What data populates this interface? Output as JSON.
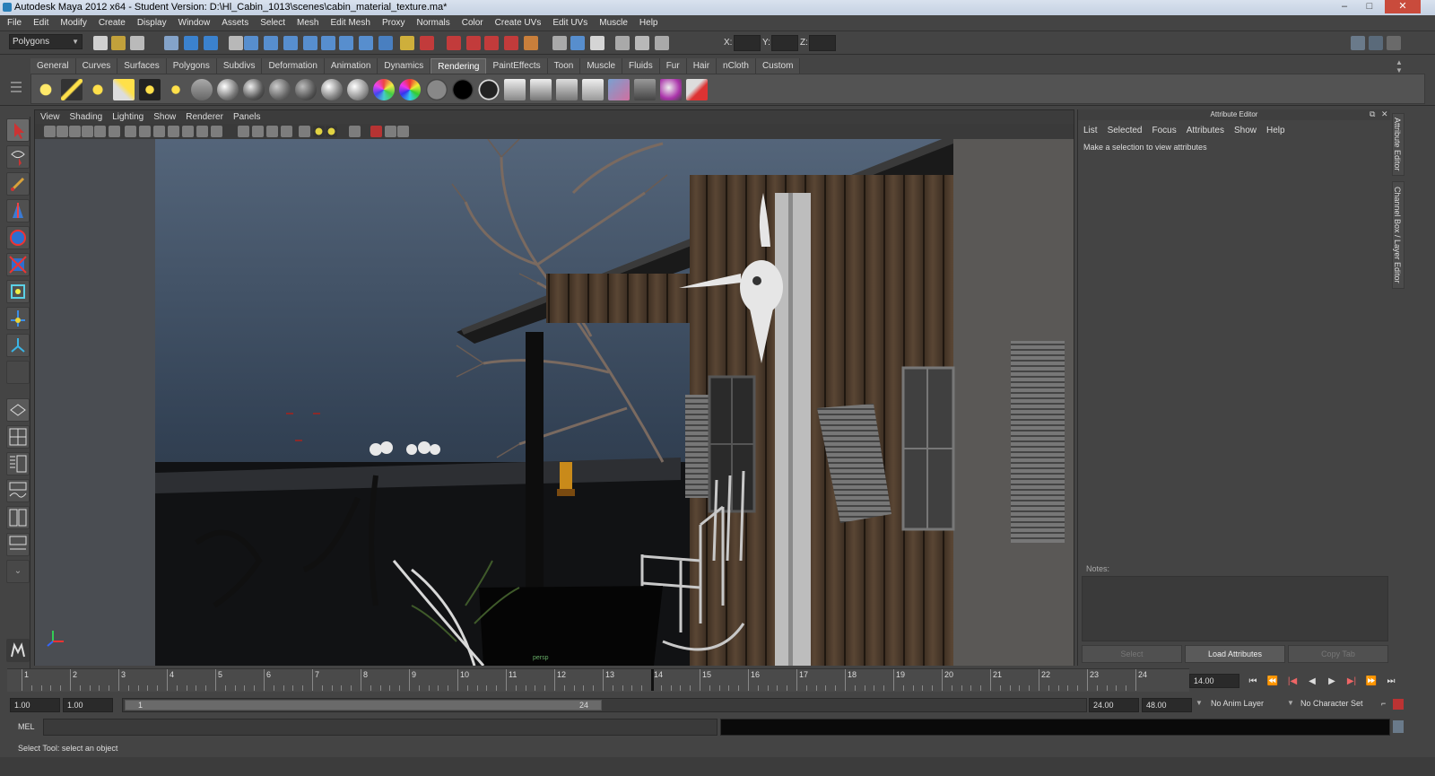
{
  "window": {
    "title": "Autodesk Maya 2012 x64 - Student Version: D:\\Hl_Cabin_1013\\scenes\\cabin_material_texture.ma*"
  },
  "menubar": [
    "File",
    "Edit",
    "Modify",
    "Create",
    "Display",
    "Window",
    "Assets",
    "Select",
    "Mesh",
    "Edit Mesh",
    "Proxy",
    "Normals",
    "Color",
    "Create UVs",
    "Edit UVs",
    "Muscle",
    "Help"
  ],
  "statusline": {
    "mode": "Polygons",
    "x_label": "X:",
    "y_label": "Y:",
    "z_label": "Z:"
  },
  "shelf": {
    "tabs": [
      "General",
      "Curves",
      "Surfaces",
      "Polygons",
      "Subdivs",
      "Deformation",
      "Animation",
      "Dynamics",
      "Rendering",
      "PaintEffects",
      "Toon",
      "Muscle",
      "Fluids",
      "Fur",
      "Hair",
      "nCloth",
      "Custom"
    ],
    "active_tab": "Rendering"
  },
  "viewport": {
    "menu": [
      "View",
      "Shading",
      "Lighting",
      "Show",
      "Renderer",
      "Panels"
    ],
    "camera_label": "persp"
  },
  "attribute_editor": {
    "title": "Attribute Editor",
    "menu": [
      "List",
      "Selected",
      "Focus",
      "Attributes",
      "Show",
      "Help"
    ],
    "message": "Make a selection to view attributes",
    "notes_label": "Notes:",
    "buttons": {
      "select": "Select",
      "load": "Load Attributes",
      "copy": "Copy Tab"
    }
  },
  "side_tabs": [
    "Attribute Editor",
    "Channel Box / Layer Editor"
  ],
  "timeline": {
    "ticks": [
      "1",
      "2",
      "3",
      "4",
      "5",
      "6",
      "7",
      "8",
      "9",
      "10",
      "11",
      "12",
      "13",
      "14",
      "15",
      "16",
      "17",
      "18",
      "19",
      "20",
      "21",
      "22",
      "23",
      "24"
    ],
    "current_frame": "14.00",
    "current_frame_value": 14
  },
  "range": {
    "start": "1.00",
    "playback_start": "1.00",
    "handle_start": "1",
    "handle_end": "24",
    "playback_end": "24.00",
    "end": "48.00",
    "anim_layer": "No Anim Layer",
    "character_set": "No Character Set"
  },
  "command_line": {
    "label": "MEL"
  },
  "help_line": {
    "text": "Select Tool: select an object"
  },
  "colors": {
    "bg": "#444444",
    "panel": "#3c3c3c",
    "viewport_sky": "#3b4a5e",
    "accent_blue": "#2a7fb8"
  }
}
